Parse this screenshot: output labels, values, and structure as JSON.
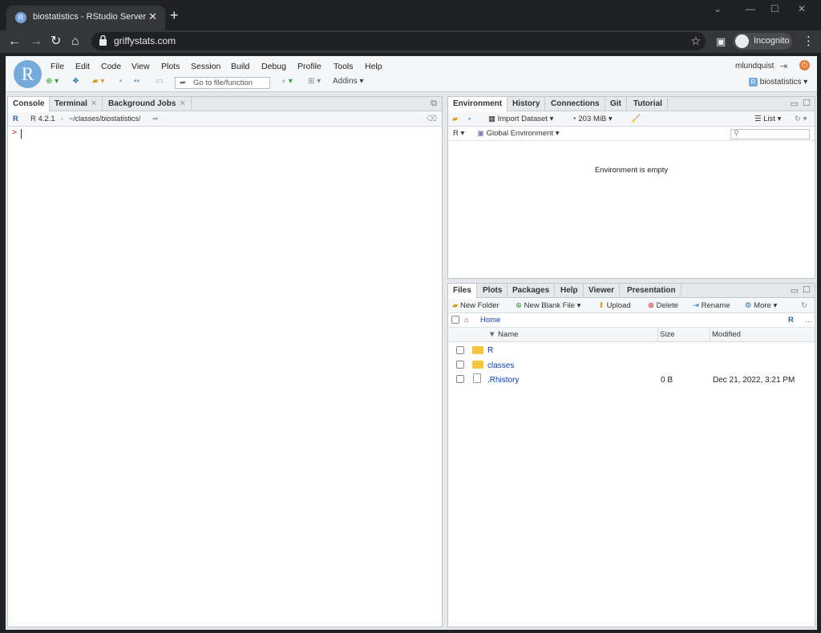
{
  "browser": {
    "tab_title": "biostatistics - RStudio Server",
    "url": "griffystats.com",
    "profile_label": "Incognito"
  },
  "rstudio": {
    "menu": [
      "File",
      "Edit",
      "Code",
      "View",
      "Plots",
      "Session",
      "Build",
      "Debug",
      "Profile",
      "Tools",
      "Help"
    ],
    "user": "mlundquist",
    "goto_placeholder": "Go to file/function",
    "addins_label": "Addins",
    "project": "biostatistics"
  },
  "console_pane": {
    "tabs": [
      "Console",
      "Terminal",
      "Background Jobs"
    ],
    "r_version": "R 4.2.1",
    "path": "~/classes/biostatistics/",
    "prompt": ">"
  },
  "environment_pane": {
    "tabs": [
      "Environment",
      "History",
      "Connections",
      "Git",
      "Tutorial"
    ],
    "import_dataset": "Import Dataset",
    "memory": "203 MiB",
    "view_mode": "List",
    "language": "R",
    "scope": "Global Environment",
    "empty_message": "Environment is empty"
  },
  "files_pane": {
    "tabs": [
      "Files",
      "Plots",
      "Packages",
      "Help",
      "Viewer",
      "Presentation"
    ],
    "toolbar": {
      "new_folder": "New Folder",
      "new_blank_file": "New Blank File",
      "upload": "Upload",
      "delete": "Delete",
      "rename": "Rename",
      "more": "More"
    },
    "breadcrumb": "Home",
    "columns": [
      "Name",
      "Size",
      "Modified"
    ],
    "files": [
      {
        "name": "R",
        "type": "folder",
        "size": "",
        "modified": ""
      },
      {
        "name": "classes",
        "type": "folder",
        "size": "",
        "modified": ""
      },
      {
        "name": ".Rhistory",
        "type": "file",
        "size": "0 B",
        "modified": "Dec 21, 2022, 3:21 PM"
      }
    ]
  }
}
